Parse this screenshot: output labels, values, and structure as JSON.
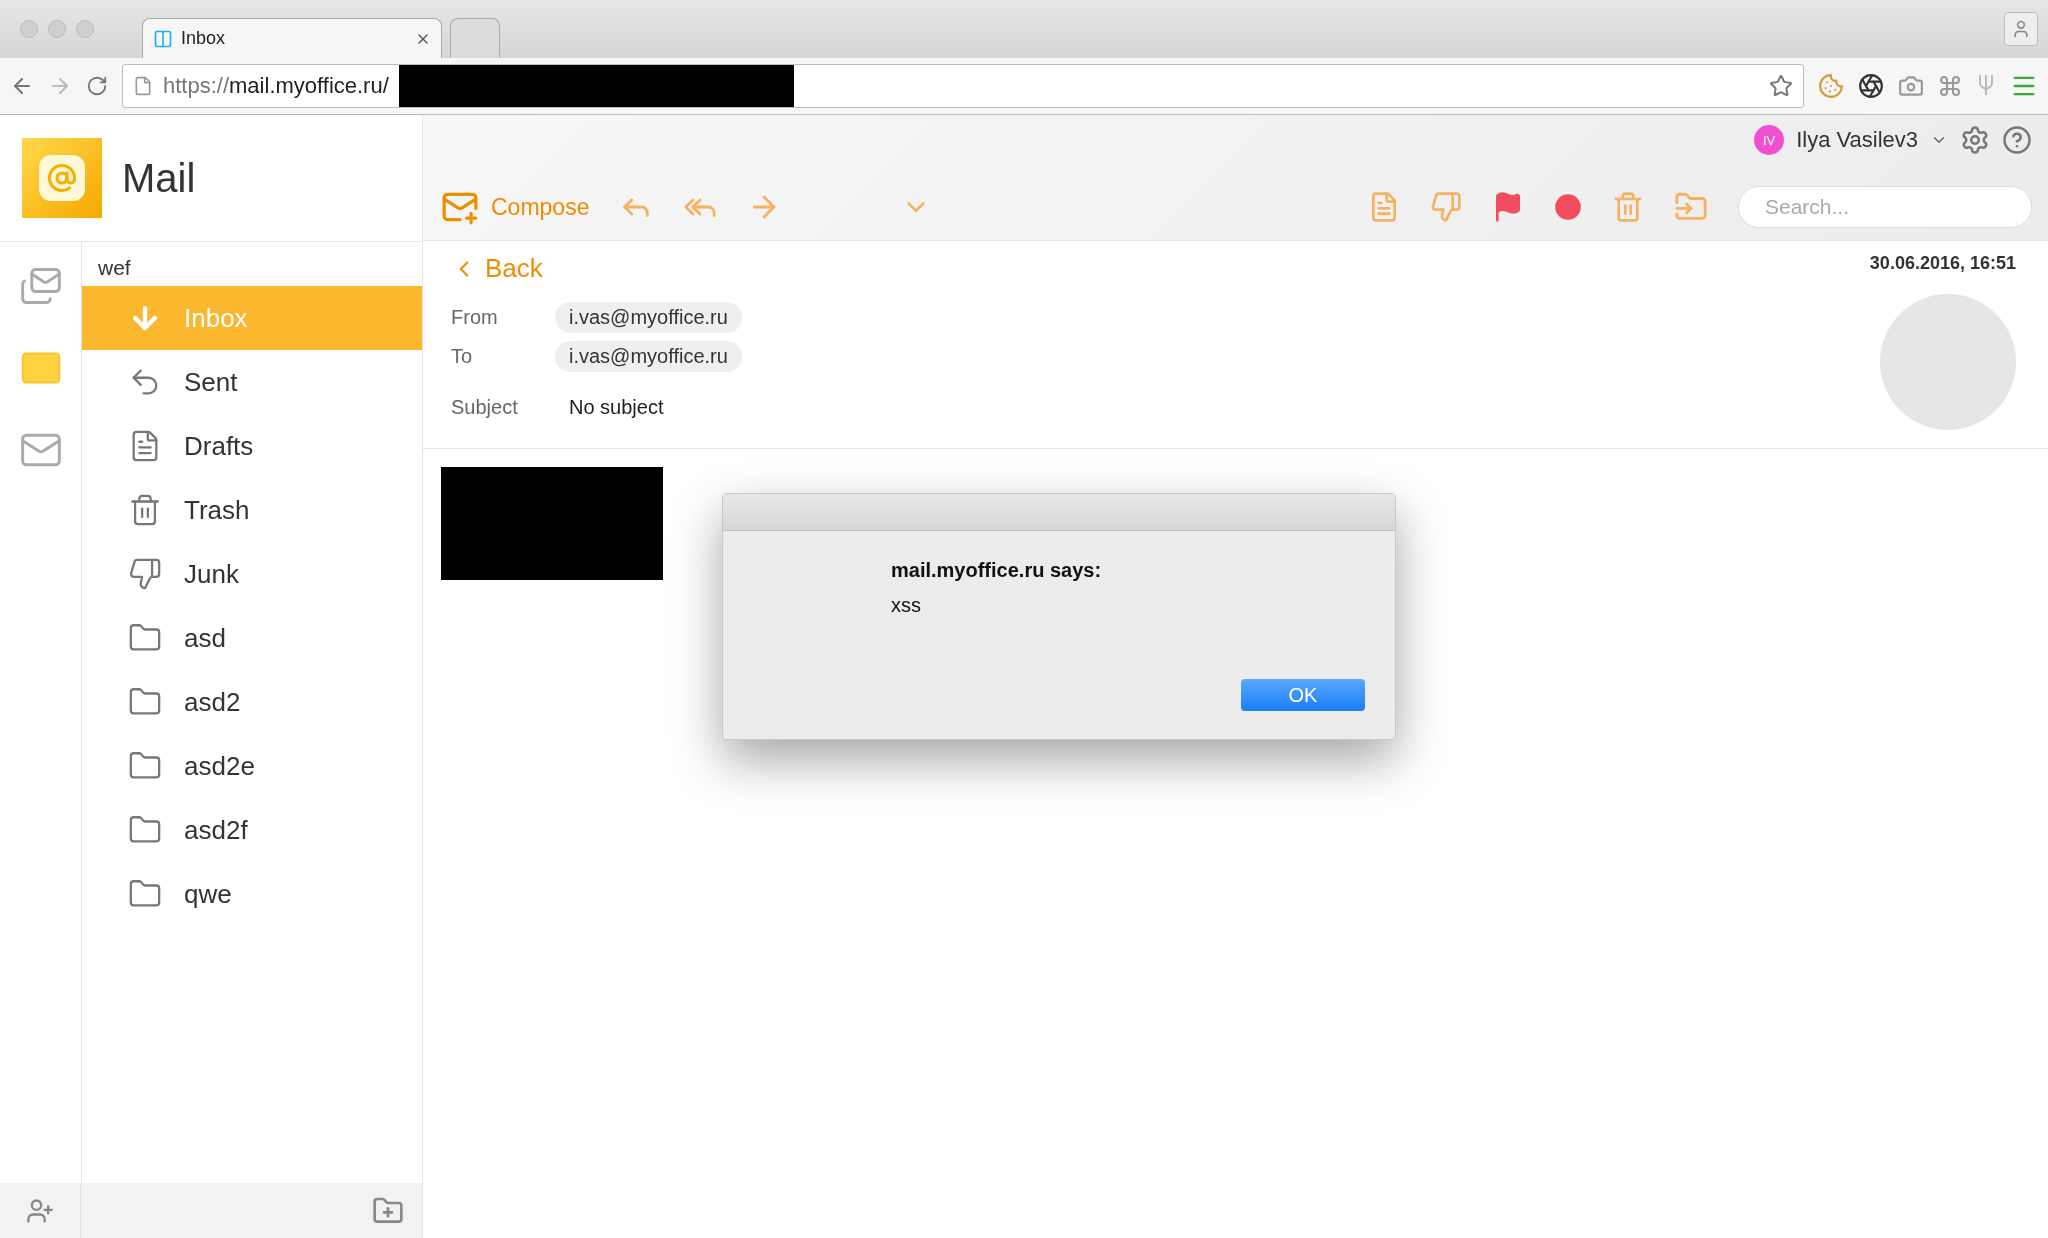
{
  "browser": {
    "tabs": [
      {
        "title": "Inbox",
        "selected": true
      },
      {
        "selected": false
      }
    ],
    "address": {
      "scheme": "https://",
      "host": "mail.myoffice.ru/"
    }
  },
  "app": {
    "title": "Mail",
    "user": {
      "initials": "IV",
      "name": "Ilya Vasilev3"
    },
    "compose": "Compose",
    "search": {
      "placeholder": "Search..."
    }
  },
  "rail": [
    {
      "kind": "stack",
      "selected": false
    },
    {
      "kind": "mail",
      "selected": true
    },
    {
      "kind": "gmail",
      "selected": false
    }
  ],
  "sidebar": {
    "account": "wef",
    "folders": [
      {
        "label": "Inbox",
        "kind": "inbox",
        "selected": true
      },
      {
        "label": "Sent",
        "kind": "sent",
        "selected": false
      },
      {
        "label": "Drafts",
        "kind": "drafts",
        "selected": false
      },
      {
        "label": "Trash",
        "kind": "trash",
        "selected": false
      },
      {
        "label": "Junk",
        "kind": "junk",
        "selected": false
      },
      {
        "label": "asd",
        "kind": "folder",
        "selected": false
      },
      {
        "label": "asd2",
        "kind": "folder",
        "selected": false
      },
      {
        "label": "asd2e",
        "kind": "folder",
        "selected": false
      },
      {
        "label": "asd2f",
        "kind": "folder",
        "selected": false
      },
      {
        "label": "qwe",
        "kind": "folder",
        "selected": false
      }
    ]
  },
  "message": {
    "back": "Back",
    "date": "30.06.2016, 16:51",
    "fields": [
      {
        "label": "From",
        "value": "i.vas@myoffice.ru"
      },
      {
        "label": "To",
        "value": "i.vas@myoffice.ru"
      }
    ],
    "subject": {
      "label": "Subject",
      "value": "No subject"
    }
  },
  "dialog": {
    "title": "mail.myoffice.ru says:",
    "message": "xss",
    "button": "OK"
  }
}
